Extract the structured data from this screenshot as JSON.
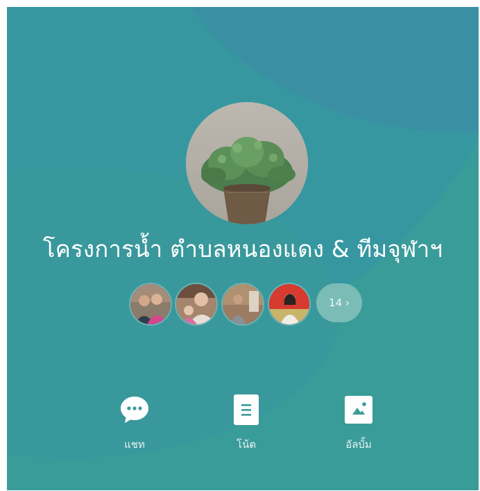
{
  "group": {
    "name": "โครงการน้ำ ตำบลหนองแดง & ทีมจุฬาฯ",
    "avatar_icon": "potted-plant-photo"
  },
  "members": {
    "avatars": [
      {
        "icon": "member-photo-couple"
      },
      {
        "icon": "member-photo-family"
      },
      {
        "icon": "member-photo-man"
      },
      {
        "icon": "member-photo-woman"
      }
    ],
    "more_label": "14 ›"
  },
  "actions": [
    {
      "label": "แชท",
      "icon": "chat-bubble-icon"
    },
    {
      "label": "โน้ต",
      "icon": "note-icon"
    },
    {
      "label": "อัลบั้ม",
      "icon": "album-icon"
    }
  ],
  "colors": {
    "background": "#3a9c99",
    "accent_light": "#7cbcb6",
    "text": "#ffffff"
  }
}
